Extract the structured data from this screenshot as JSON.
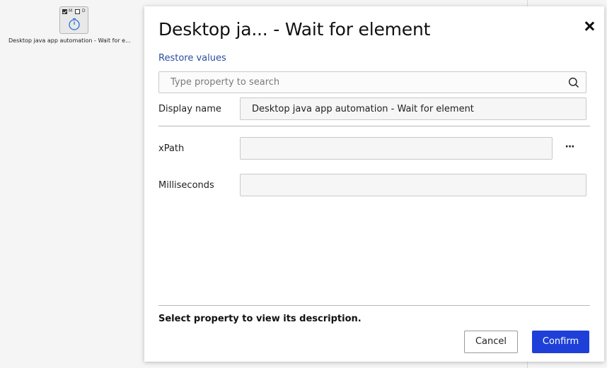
{
  "canvas": {
    "node": {
      "checkbox1_letter": "M",
      "checkbox2_letter": "D",
      "icon": "stopwatch-icon",
      "caption": "Desktop java app automation - Wait for e..."
    }
  },
  "dialog": {
    "title": "Desktop ja... - Wait for element",
    "close_icon": "close-icon",
    "restore_link": "Restore values",
    "search": {
      "placeholder": "Type property to search",
      "value": "",
      "icon": "search-icon"
    },
    "properties": {
      "display_name": {
        "label": "Display name",
        "value": "Desktop java app automation - Wait for element"
      },
      "xpath": {
        "label": "xPath",
        "value": "",
        "more_label": "···"
      },
      "milliseconds": {
        "label": "Milliseconds",
        "value": ""
      }
    },
    "description": "Select property to view its description.",
    "buttons": {
      "cancel": "Cancel",
      "confirm": "Confirm"
    }
  },
  "colors": {
    "accent": "#1e40d8",
    "link": "#2b4ea2",
    "timer_icon": "#2f6fd6"
  }
}
